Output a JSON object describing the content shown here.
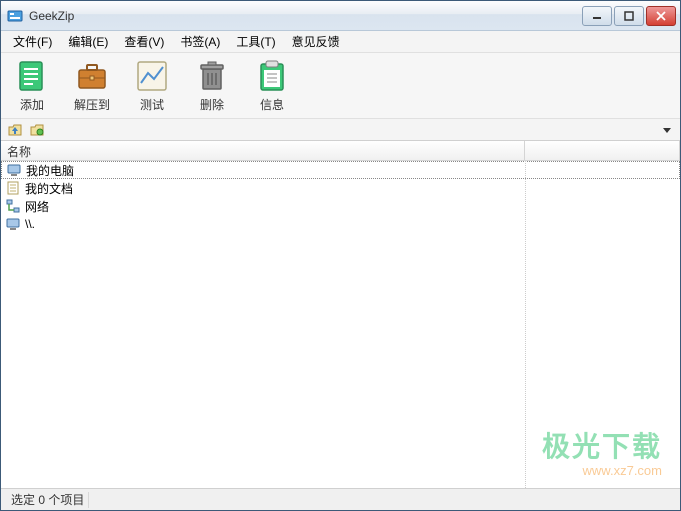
{
  "window": {
    "title": "GeekZip"
  },
  "menu": {
    "file": "文件(F)",
    "edit": "编辑(E)",
    "view": "查看(V)",
    "bookmarks": "书签(A)",
    "tools": "工具(T)",
    "feedback": "意见反馈"
  },
  "toolbar": {
    "add": "添加",
    "extract_to": "解压到",
    "test": "测试",
    "delete": "删除",
    "info": "信息"
  },
  "list": {
    "header": {
      "name": "名称"
    },
    "items": [
      {
        "label": "我的电脑",
        "icon": "computer"
      },
      {
        "label": "我的文档",
        "icon": "document"
      },
      {
        "label": "网络",
        "icon": "network"
      },
      {
        "label": "\\\\.",
        "icon": "computer"
      }
    ]
  },
  "status": {
    "selection": "选定 0 个项目"
  },
  "watermark": {
    "line1": "极光下载",
    "line2": "www.xz7.com"
  }
}
